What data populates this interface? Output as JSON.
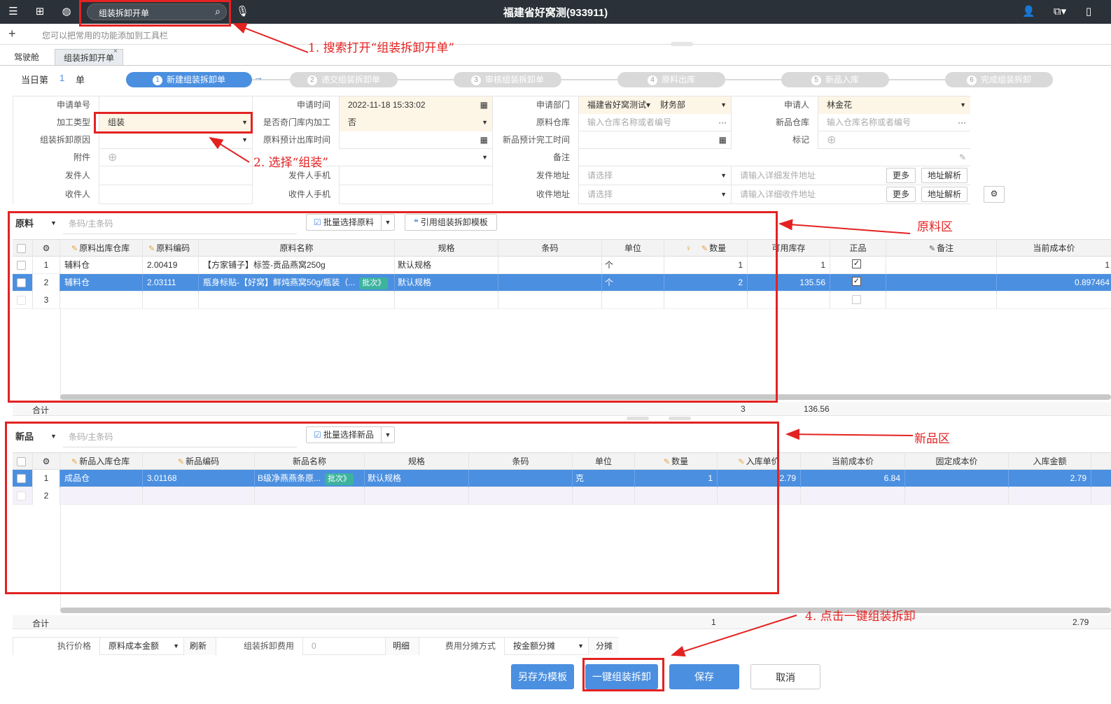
{
  "topbar": {
    "search_value": "组装拆卸开单",
    "title": "福建省好窝测(933911)"
  },
  "toolbar_hint": "您可以把常用的功能添加到工具栏",
  "tabs": [
    {
      "label": "驾驶舱"
    },
    {
      "label": "组装拆卸开单"
    }
  ],
  "day_counter": {
    "prefix": "当日第",
    "value": "1",
    "suffix": "单"
  },
  "steps": [
    {
      "num": "1",
      "label": "新建组装拆卸单"
    },
    {
      "num": "2",
      "label": "递交组装拆卸单"
    },
    {
      "num": "3",
      "label": "审核组装拆卸单"
    },
    {
      "num": "4",
      "label": "原料出库"
    },
    {
      "num": "5",
      "label": "新品入库"
    },
    {
      "num": "6",
      "label": "完成组装拆卸"
    }
  ],
  "form": {
    "l_order_no": "申请单号",
    "l_time": "申请时间",
    "time": "2022-11-18 15:33:02",
    "l_dept": "申请部门",
    "dept": "福建省好窝测试▾",
    "dept2": "财务部",
    "l_applicant": "申请人",
    "applicant": "林金花",
    "l_type": "加工类型",
    "type": "组装",
    "l_store": "是否奇门库内加工",
    "store": "否",
    "l_raw_wh": "原料仓库",
    "raw_wh_ph": "输入仓库名称或者编号",
    "l_new_wh": "新品仓库",
    "new_wh_ph": "输入仓库名称或者编号",
    "l_reason": "组装拆卸原因",
    "l_out_time": "原料预计出库时间",
    "l_done_time": "新品预计完工时间",
    "l_mark": "标记",
    "l_attach": "附件",
    "l_remark": "备注",
    "l_sender": "发件人",
    "l_sender_phone": "发件人手机",
    "l_send_addr": "发件地址",
    "send_addr_ph": "请选择",
    "send_detail_ph": "请输入详细发件地址",
    "l_receiver": "收件人",
    "l_receiver_phone": "收件人手机",
    "l_recv_addr": "收件地址",
    "recv_addr_ph": "请选择",
    "recv_detail_ph": "请输入详细收件地址",
    "more": "更多",
    "parse": "地址解析"
  },
  "raw": {
    "title": "原料",
    "barcode_ph": "条码/主条码",
    "batch_btn": "批量选择原料",
    "template_btn": "引用组装拆卸模板",
    "headers": [
      "原料出库仓库",
      "原料编码",
      "原料名称",
      "规格",
      "条码",
      "单位",
      "数量",
      "可用库存",
      "正品",
      "备注",
      "当前成本价"
    ],
    "rows": [
      {
        "no": "1",
        "wh": "辅料仓",
        "code": "2.00419",
        "name": "【方家铺子】标签-贡品燕窝250g",
        "spec": "默认规格",
        "barcode": "",
        "unit": "个",
        "qty": "1",
        "stock": "1",
        "cost": "1"
      },
      {
        "no": "2",
        "wh": "辅料仓",
        "code": "2.03111",
        "name": "瓶身标贴-【好窝】鲜炖燕窝50g/瓶装（...",
        "badge": "批次》",
        "spec": "默认规格",
        "barcode": "",
        "unit": "个",
        "qty": "2",
        "stock": "135.56",
        "cost": "0.897464"
      },
      {
        "no": "3"
      }
    ],
    "total_label": "合计",
    "total_qty": "3",
    "total_stock": "136.56"
  },
  "new": {
    "title": "新品",
    "barcode_ph": "条码/主条码",
    "batch_btn": "批量选择新品",
    "headers": [
      "新品入库仓库",
      "新品编码",
      "新品名称",
      "规格",
      "条码",
      "单位",
      "数量",
      "入库单价",
      "当前成本价",
      "固定成本价",
      "入库金额"
    ],
    "rows": [
      {
        "no": "1",
        "wh": "成品仓",
        "code": "3.01168",
        "name": "B级净燕燕条原...",
        "badge": "批次》",
        "spec": "默认规格",
        "barcode": "",
        "unit": "克",
        "qty": "1",
        "price": "2.79",
        "cost": "6.84",
        "fixed": "",
        "amount": "2.79"
      },
      {
        "no": "2"
      }
    ],
    "total_label": "合计",
    "total_qty": "1",
    "total_amount": "2.79"
  },
  "bottom": {
    "l_exec": "执行价格",
    "exec": "原料成本金额",
    "refresh": "刷新",
    "l_fee": "组装拆卸费用",
    "fee": "0",
    "detail": "明细",
    "l_split": "费用分摊方式",
    "split": "按金额分摊",
    "split_btn": "分摊"
  },
  "actions": {
    "save_template": "另存为模板",
    "one_key": "一键组装拆卸",
    "save": "保存",
    "cancel": "取消"
  },
  "annotations": {
    "a1": "1. 搜索打开“组装拆卸开单”",
    "a2": "2. 选择“组装”",
    "a3": "原料区",
    "a4": "新品区",
    "a5": "4. 点击一键组装拆卸"
  }
}
